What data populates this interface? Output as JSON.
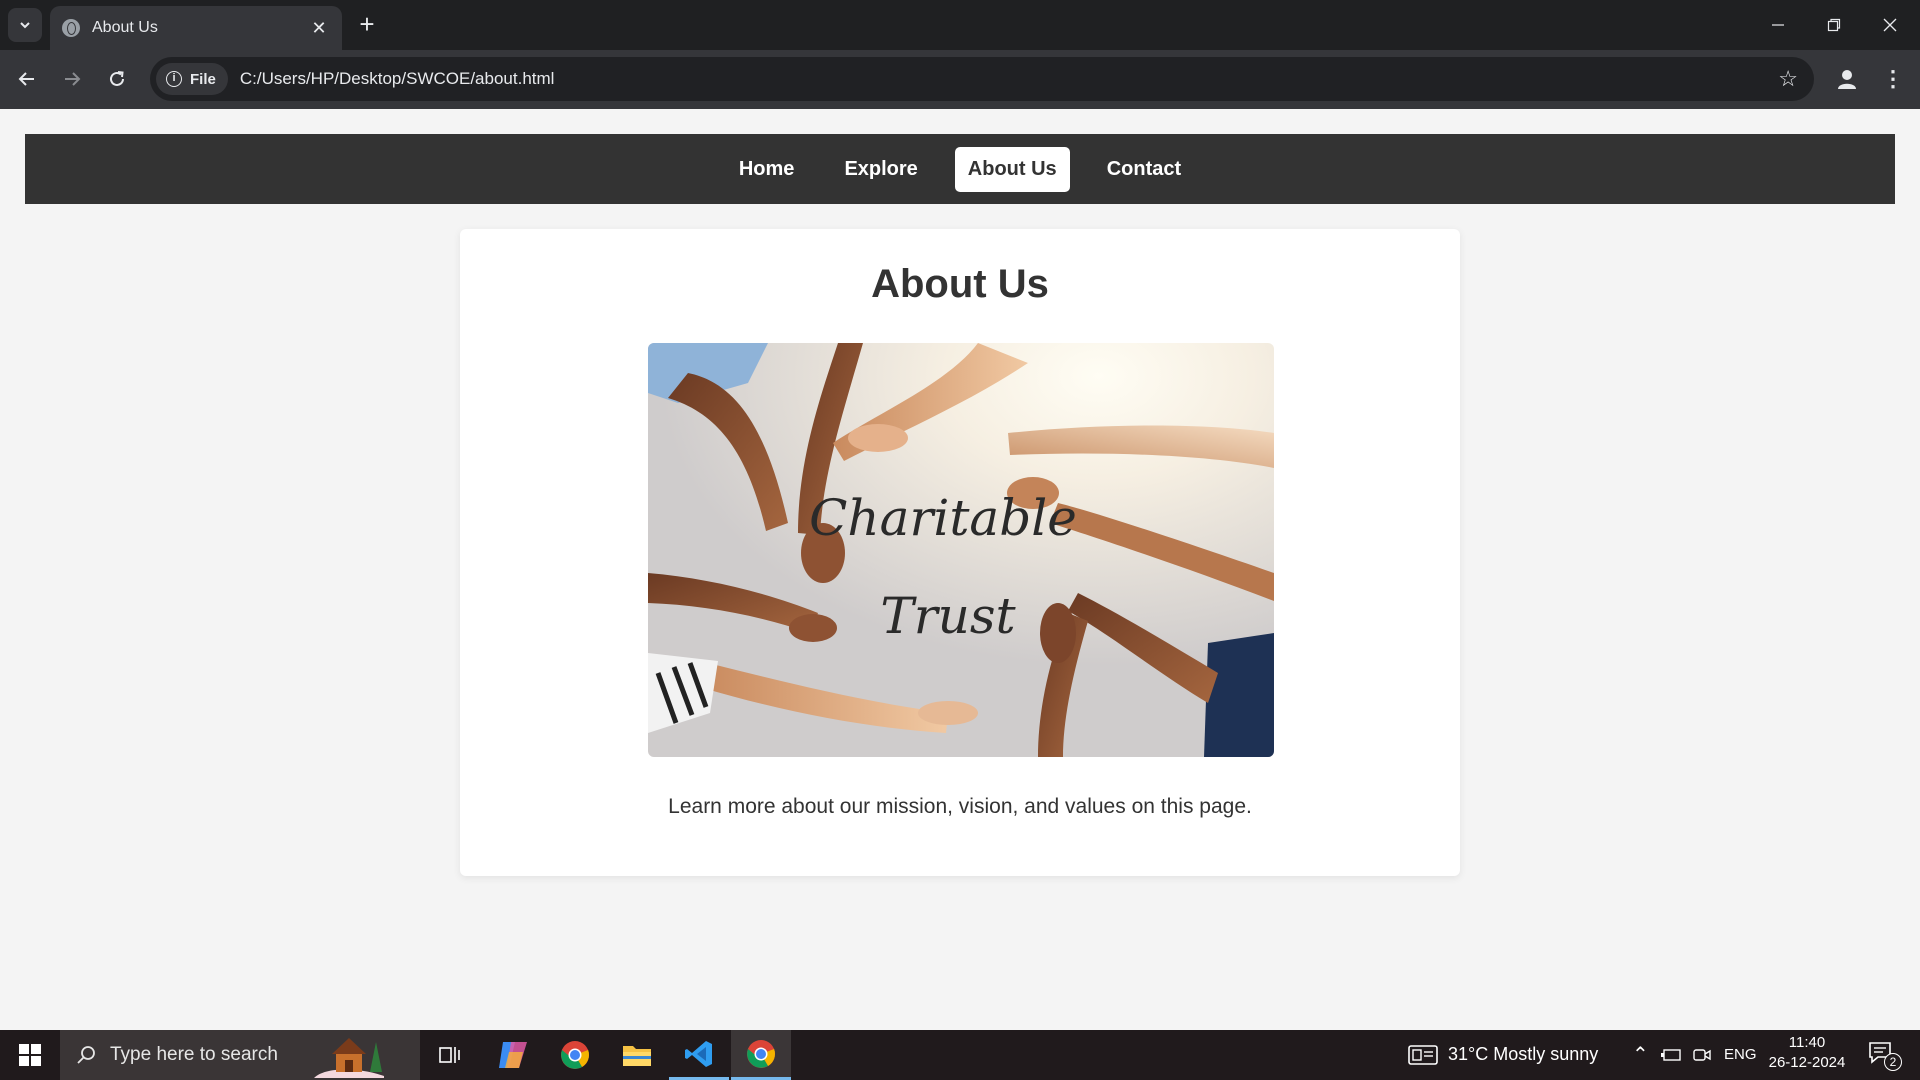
{
  "browser": {
    "tab_title": "About Us",
    "address_chip": "File",
    "url": "C:/Users/HP/Desktop/SWCOE/about.html"
  },
  "site": {
    "nav": [
      "Home",
      "Explore",
      "About Us",
      "Contact"
    ],
    "active_nav": "About Us",
    "heading": "About Us",
    "hero_text_line1": "Charitable",
    "hero_text_line2": "Trust",
    "paragraph": "Learn more about our mission, vision, and values on this page."
  },
  "taskbar": {
    "search_placeholder": "Type here to search",
    "weather": "31°C  Mostly sunny",
    "language": "ENG",
    "time": "11:40",
    "date": "26-12-2024",
    "notification_count": "2"
  },
  "colors": {
    "nav_bg": "#333333",
    "page_bg": "#f4f4f4",
    "card_bg": "#ffffff",
    "chrome_dark": "#1f2022",
    "chrome_toolbar": "#35363a",
    "accent_blue": "#76b9ed"
  }
}
